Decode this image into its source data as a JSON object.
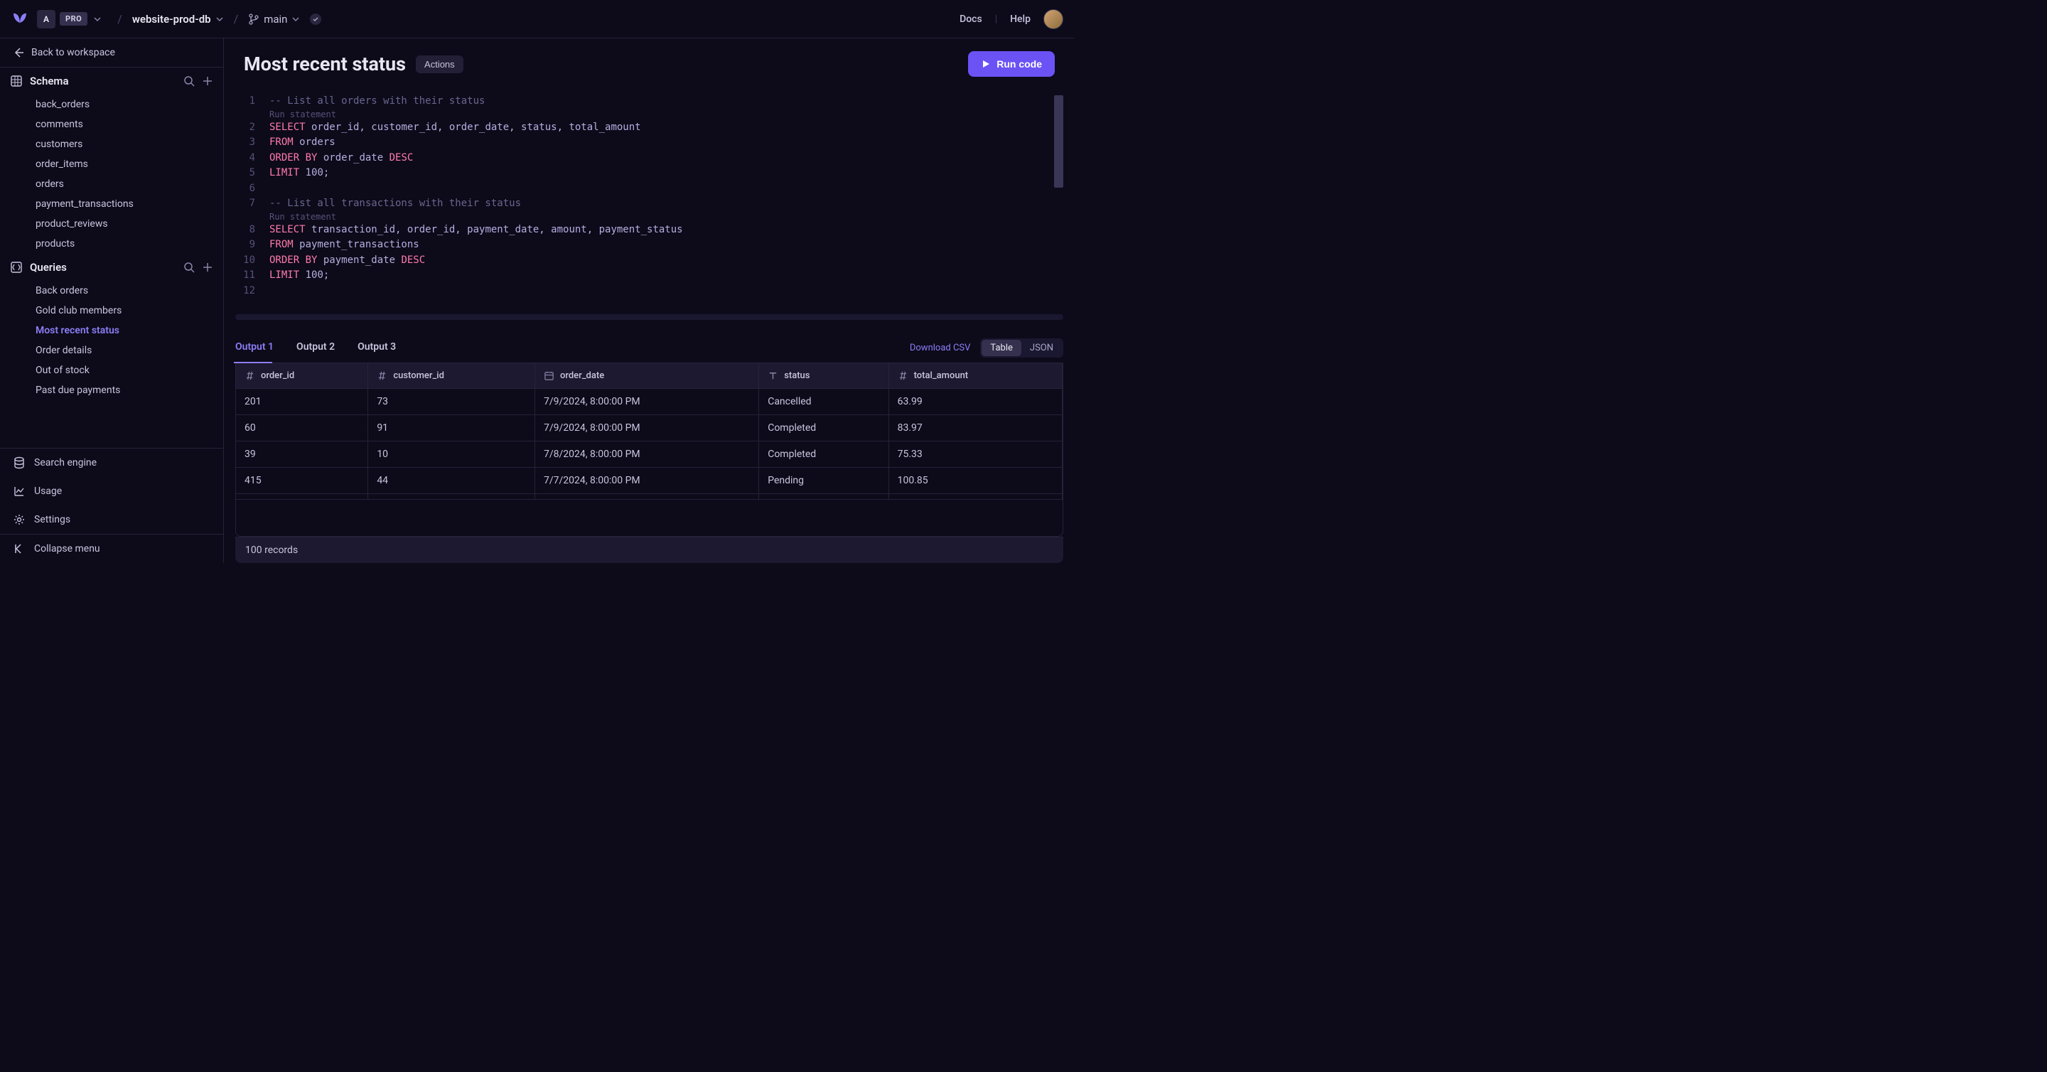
{
  "topbar": {
    "workspace_initial": "A",
    "pro_label": "PRO",
    "db_name": "website-prod-db",
    "branch": "main",
    "docs": "Docs",
    "help": "Help"
  },
  "sidebar": {
    "back": "Back to workspace",
    "schema_header": "Schema",
    "schema_items": [
      "back_orders",
      "comments",
      "customers",
      "order_items",
      "orders",
      "payment_transactions",
      "product_reviews",
      "products"
    ],
    "queries_header": "Queries",
    "queries_items": [
      "Back orders",
      "Gold club members",
      "Most recent status",
      "Order details",
      "Out of stock",
      "Past due payments"
    ],
    "active_query_index": 2,
    "bottom": {
      "search": "Search engine",
      "usage": "Usage",
      "settings": "Settings",
      "collapse": "Collapse menu"
    }
  },
  "main": {
    "title": "Most recent status",
    "actions_btn": "Actions",
    "run_btn": "Run code",
    "run_stmt": "Run statement"
  },
  "code": [
    {
      "n": "1",
      "tokens": [
        [
          "comment",
          "-- List all orders with their status"
        ]
      ]
    },
    {
      "run": true
    },
    {
      "n": "2",
      "tokens": [
        [
          "kw",
          "SELECT"
        ],
        [
          "ident",
          " order_id, customer_id, order_date, status, total_amount"
        ]
      ]
    },
    {
      "n": "3",
      "tokens": [
        [
          "kw",
          "FROM"
        ],
        [
          "ident",
          " orders"
        ]
      ]
    },
    {
      "n": "4",
      "tokens": [
        [
          "kw",
          "ORDER BY"
        ],
        [
          "ident",
          " order_date "
        ],
        [
          "kw",
          "DESC"
        ]
      ]
    },
    {
      "n": "5",
      "tokens": [
        [
          "kw",
          "LIMIT"
        ],
        [
          "ident",
          " 100;"
        ]
      ]
    },
    {
      "n": "6",
      "tokens": []
    },
    {
      "n": "7",
      "tokens": [
        [
          "comment",
          "-- List all transactions with their status"
        ]
      ]
    },
    {
      "run": true
    },
    {
      "n": "8",
      "tokens": [
        [
          "kw",
          "SELECT"
        ],
        [
          "ident",
          " transaction_id, order_id, payment_date, amount, payment_status"
        ]
      ]
    },
    {
      "n": "9",
      "tokens": [
        [
          "kw",
          "FROM"
        ],
        [
          "ident",
          " payment_transactions"
        ]
      ]
    },
    {
      "n": "10",
      "tokens": [
        [
          "kw",
          "ORDER BY"
        ],
        [
          "ident",
          " payment_date "
        ],
        [
          "kw",
          "DESC"
        ]
      ]
    },
    {
      "n": "11",
      "tokens": [
        [
          "kw",
          "LIMIT"
        ],
        [
          "ident",
          " 100;"
        ]
      ]
    },
    {
      "n": "12",
      "tokens": []
    }
  ],
  "output": {
    "tabs": [
      "Output 1",
      "Output 2",
      "Output 3"
    ],
    "active_tab": 0,
    "download": "Download CSV",
    "toggle_table": "Table",
    "toggle_json": "JSON",
    "columns": [
      {
        "type": "num",
        "label": "order_id"
      },
      {
        "type": "num",
        "label": "customer_id"
      },
      {
        "type": "date",
        "label": "order_date"
      },
      {
        "type": "text",
        "label": "status"
      },
      {
        "type": "num",
        "label": "total_amount"
      }
    ],
    "rows": [
      [
        "201",
        "73",
        "7/9/2024, 8:00:00 PM",
        "Cancelled",
        "63.99"
      ],
      [
        "60",
        "91",
        "7/9/2024, 8:00:00 PM",
        "Completed",
        "83.97"
      ],
      [
        "39",
        "10",
        "7/8/2024, 8:00:00 PM",
        "Completed",
        "75.33"
      ],
      [
        "415",
        "44",
        "7/7/2024, 8:00:00 PM",
        "Pending",
        "100.85"
      ]
    ],
    "footer": "100 records"
  }
}
